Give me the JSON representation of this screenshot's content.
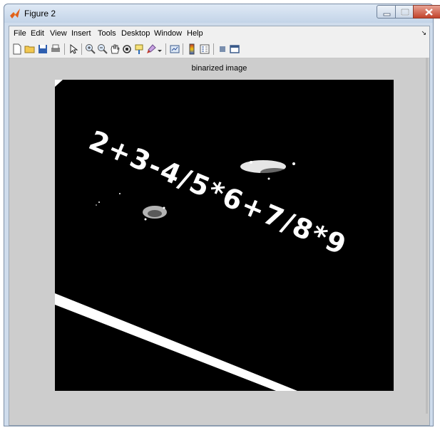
{
  "window": {
    "title": "Figure 2",
    "controls": [
      "minimize",
      "maximize",
      "close"
    ]
  },
  "menu": {
    "items": [
      "File",
      "Edit",
      "View",
      "Insert",
      "Tools",
      "Desktop",
      "Window",
      "Help"
    ],
    "overflow_glyph": "↘"
  },
  "toolbar": {
    "icons": [
      "new-figure-icon",
      "open-file-icon",
      "save-icon",
      "print-icon",
      "edit-plot-icon",
      "zoom-in-icon",
      "zoom-out-icon",
      "pan-icon",
      "rotate-3d-icon",
      "data-cursor-icon",
      "brush-icon",
      "link-plot-icon",
      "insert-colorbar-icon",
      "insert-legend-icon",
      "hide-plot-tools-icon",
      "show-plot-tools-icon"
    ]
  },
  "axes": {
    "title": "binarized image",
    "image_text": "2+3-4/5*6+7/8*9"
  },
  "colors": {
    "figure_bg": "#cdcdcd",
    "image_bg": "#000000",
    "image_fg": "#ffffff"
  }
}
